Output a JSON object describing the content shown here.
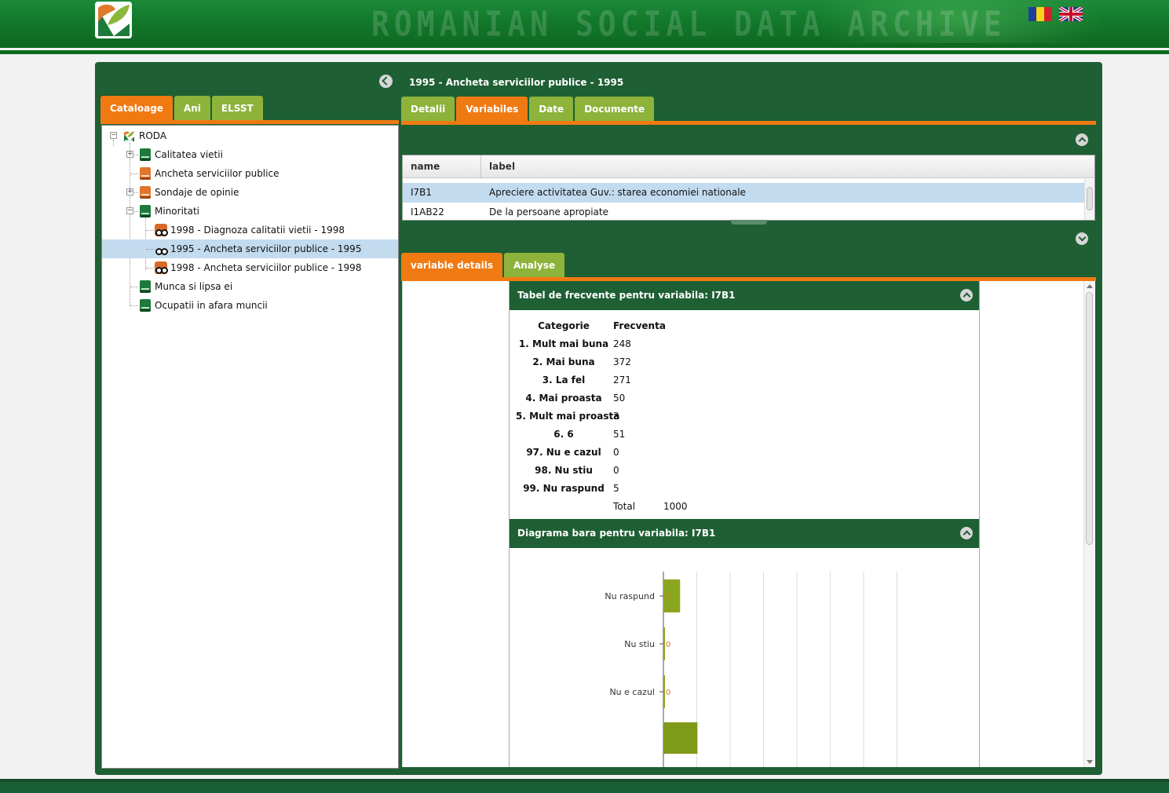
{
  "header": {
    "brand": "ROMANIAN SOCIAL DATA ARCHIVE",
    "flags": [
      "flag-ro-icon",
      "flag-uk-icon"
    ]
  },
  "left": {
    "tabs": [
      {
        "label": "Cataloage",
        "active": true
      },
      {
        "label": "Ani",
        "active": false
      },
      {
        "label": "ELSST",
        "active": false
      }
    ],
    "tree": [
      {
        "label": "RODA",
        "level": 0,
        "icon": "roda-logo-icon"
      },
      {
        "label": "Calitatea vietii",
        "level": 1,
        "icon": "green-book-icon"
      },
      {
        "label": "Ancheta serviciilor publice",
        "level": 1,
        "icon": "orange-book-icon"
      },
      {
        "label": "Sondaje de opinie",
        "level": 1,
        "icon": "orange-book-icon"
      },
      {
        "label": "Minoritati",
        "level": 1,
        "icon": "green-book-icon"
      },
      {
        "label": "1998 - Diagnoza calitatii vietii - 1998",
        "level": 2,
        "icon": "binoculars-icon"
      },
      {
        "label": "1995 - Ancheta serviciilor publice - 1995",
        "level": 2,
        "icon": "binoculars-icon",
        "selected": true
      },
      {
        "label": "1998 - Ancheta serviciilor publice - 1998",
        "level": 2,
        "icon": "binoculars-icon"
      },
      {
        "label": "Munca si lipsa ei",
        "level": 1,
        "icon": "green-book-icon"
      },
      {
        "label": "Ocupatii in afara muncii",
        "level": 1,
        "icon": "green-book-icon"
      }
    ]
  },
  "right": {
    "title": "1995 - Ancheta serviciilor publice - 1995",
    "tabs": [
      {
        "label": "Detalii",
        "active": false
      },
      {
        "label": "Variabiles",
        "active": true
      },
      {
        "label": "Date",
        "active": false
      },
      {
        "label": "Documente",
        "active": false
      }
    ],
    "grid": {
      "columns": [
        "name",
        "label"
      ],
      "rows": [
        {
          "name": "I7B1",
          "label": "Apreciere activitatea Guv.: starea economiei nationale",
          "selected": true
        },
        {
          "name": "I1AB22",
          "label": "De la persoane apropiate",
          "selected": false
        }
      ]
    },
    "detail_tabs": [
      {
        "label": "variable details",
        "active": true
      },
      {
        "label": "Analyse",
        "active": false
      }
    ],
    "freq": {
      "title": "Tabel de frecvente pentru variabila: I7B1",
      "col_cat": "Categorie",
      "col_freq": "Frecventa",
      "rows": [
        {
          "cat": "1. Mult mai buna",
          "freq": "248"
        },
        {
          "cat": "2. Mai buna",
          "freq": "372"
        },
        {
          "cat": "3. La fel",
          "freq": "271"
        },
        {
          "cat": "4. Mai proasta",
          "freq": "50"
        },
        {
          "cat": "5. Mult mai proasta",
          "freq": "3"
        },
        {
          "cat": "6. 6",
          "freq": "51"
        },
        {
          "cat": "97. Nu e cazul",
          "freq": "0"
        },
        {
          "cat": "98. Nu stiu",
          "freq": "0"
        },
        {
          "cat": "99. Nu raspund",
          "freq": "5"
        }
      ],
      "total_label": "Total",
      "total": "1000"
    },
    "bar": {
      "title": "Diagrama bara pentru variabila: I7B1"
    }
  },
  "chart_data": {
    "type": "bar",
    "orientation": "horizontal",
    "categories": [
      "Nu raspund",
      "Nu stiu",
      "Nu e cazul"
    ],
    "values": [
      5,
      0,
      0
    ],
    "value_labels": [
      "5",
      "0",
      "0"
    ],
    "grid": true,
    "partial_visible_category_value": 51,
    "colors": {
      "bar": "#8aa61e",
      "value_label": "#e07a2a"
    }
  }
}
